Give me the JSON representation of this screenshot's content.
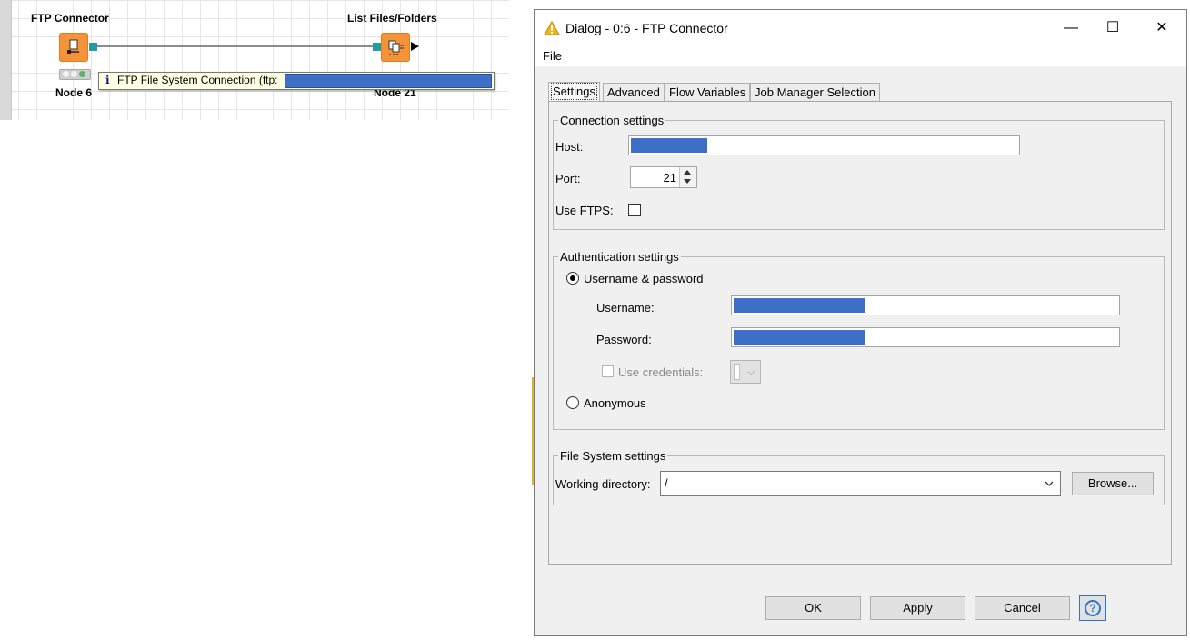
{
  "workflow": {
    "ftp_node": {
      "title": "FTP Connector",
      "label": "Node 6"
    },
    "list_node": {
      "title": "List Files/Folders",
      "label": "Node 21"
    },
    "tooltip": {
      "text": "FTP File System Connection (ftp:"
    }
  },
  "dialog": {
    "title": "Dialog - 0:6 - FTP Connector",
    "window_controls": {
      "minimize": "—",
      "maximize": "☐",
      "close": "✕"
    },
    "menu": [
      "File"
    ],
    "tabs": [
      "Settings",
      "Advanced",
      "Flow Variables",
      "Job Manager Selection"
    ],
    "active_tab": "Settings",
    "connection": {
      "legend": "Connection settings",
      "host_label": "Host:",
      "port_label": "Port:",
      "port_value": "21",
      "ftps_label": "Use FTPS:"
    },
    "auth": {
      "legend": "Authentication settings",
      "userpass_label": "Username & password",
      "username_label": "Username:",
      "password_label": "Password:",
      "credentials_label": "Use credentials:",
      "anonymous_label": "Anonymous"
    },
    "filesystem": {
      "legend": "File System settings",
      "wd_label": "Working directory:",
      "wd_value": "/",
      "browse_label": "Browse..."
    },
    "buttons": {
      "ok": "OK",
      "apply": "Apply",
      "cancel": "Cancel",
      "help": "?"
    }
  },
  "colors": {
    "node_orange": "#f5933b",
    "port_teal": "#1f9da3",
    "redaction_blue": "#3d6fc7",
    "help_blue": "#2f74c6"
  }
}
